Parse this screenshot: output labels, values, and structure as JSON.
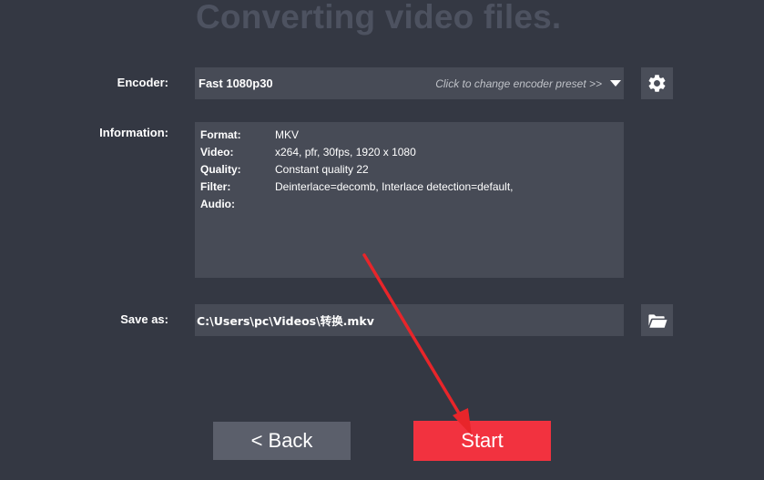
{
  "title": "Converting video files.",
  "encoder": {
    "label": "Encoder:",
    "value": "Fast 1080p30",
    "hint": "Click to change encoder preset >>",
    "settings_icon": "gear-icon"
  },
  "information": {
    "label": "Information:",
    "rows": [
      {
        "key": "Format:",
        "value": "MKV"
      },
      {
        "key": "Video:",
        "value": "x264, pfr, 30fps, 1920 x 1080"
      },
      {
        "key": "Quality:",
        "value": "Constant quality 22"
      },
      {
        "key": "Filter:",
        "value": "Deinterlace=decomb, Interlace detection=default,"
      },
      {
        "key": "Audio:",
        "value": ""
      }
    ]
  },
  "save_as": {
    "label": "Save as:",
    "value": "C:\\Users\\pc\\Videos\\转换.mkv",
    "browse_icon": "folder-open-icon"
  },
  "buttons": {
    "back_label": "<  Back",
    "start_label": "Start"
  },
  "colors": {
    "background": "#343843",
    "field": "#474b56",
    "start": "#f2323f",
    "back": "#5b5f6b",
    "annotation_arrow": "#e8252a"
  }
}
